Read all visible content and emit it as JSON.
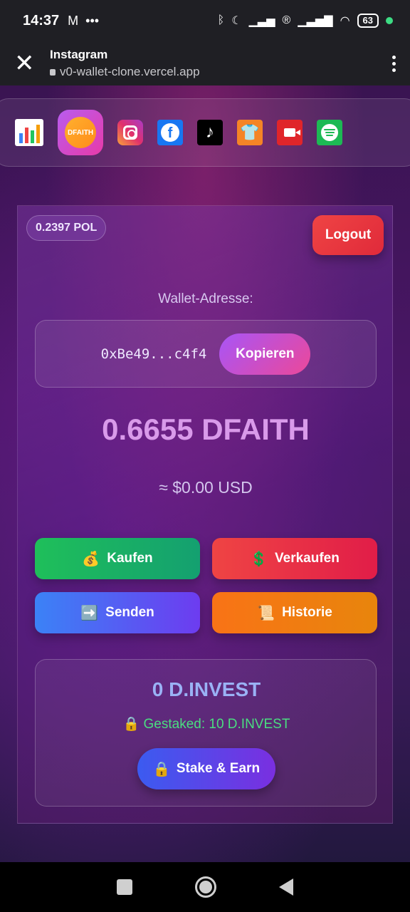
{
  "status_bar": {
    "time": "14:37",
    "left_icons": [
      "gmail-icon",
      "more-dots-icon"
    ],
    "right_icons": [
      "bluetooth-icon",
      "moon-icon",
      "signal-off-icon",
      "registered-icon",
      "signal-icon",
      "wifi-icon"
    ],
    "battery": "63"
  },
  "browser": {
    "app_title": "Instagram",
    "url": "v0-wallet-clone.vercel.app"
  },
  "app_strip": {
    "items": [
      {
        "name": "chart-app",
        "icon": "bar-chart-icon"
      },
      {
        "name": "dfaith-app",
        "icon": "dfaith-logo-icon",
        "label": "DFAITH"
      },
      {
        "name": "instagram-app",
        "icon": "instagram-icon"
      },
      {
        "name": "facebook-app",
        "icon": "facebook-icon",
        "glyph": "f"
      },
      {
        "name": "tiktok-app",
        "icon": "tiktok-icon",
        "glyph": "♪"
      },
      {
        "name": "shop-app",
        "icon": "tshirt-icon",
        "glyph": "👕"
      },
      {
        "name": "video-app",
        "icon": "video-camera-icon"
      },
      {
        "name": "spotify-app",
        "icon": "spotify-icon"
      }
    ]
  },
  "wallet": {
    "pol_balance": "0.2397 POL",
    "logout_label": "Logout",
    "address_label": "Wallet-Adresse:",
    "address": "0xBe49...c4f4",
    "copy_label": "Kopieren",
    "balance": "0.6655 DFAITH",
    "usd_value": "≈ $0.00 USD",
    "actions": {
      "buy": {
        "icon": "money-bag-icon",
        "emoji": "💰",
        "label": "Kaufen"
      },
      "sell": {
        "icon": "dollar-sign-icon",
        "emoji": "💲",
        "label": "Verkaufen"
      },
      "send": {
        "icon": "right-arrow-icon",
        "emoji": "➡️",
        "label": "Senden"
      },
      "history": {
        "icon": "scroll-icon",
        "emoji": "📜",
        "label": "Historie"
      }
    },
    "invest": {
      "amount": "0 D.INVEST",
      "staked": "🔒 Gestaked: 10 D.INVEST",
      "stake_button_emoji": "🔒",
      "stake_button_label": "Stake & Earn"
    }
  },
  "colors": {
    "balance_text": "#d99aea",
    "invest_amount": "#9ab2f5",
    "staked_text": "#4ade80"
  }
}
